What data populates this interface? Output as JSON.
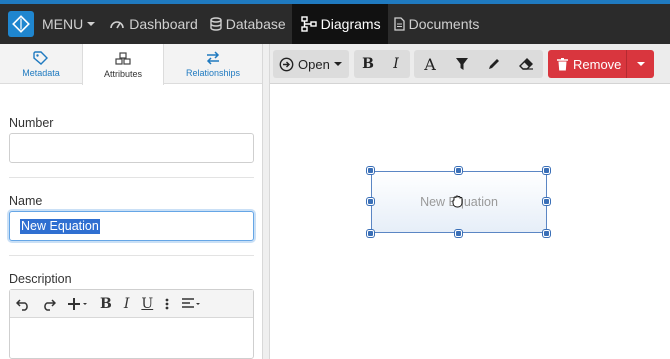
{
  "nav": {
    "menu_label": "MENU",
    "items": [
      {
        "label": "Dashboard",
        "icon": "dashboard-icon"
      },
      {
        "label": "Database",
        "icon": "database-icon"
      },
      {
        "label": "Diagrams",
        "icon": "diagram-icon",
        "active": true
      },
      {
        "label": "Documents",
        "icon": "document-icon"
      }
    ]
  },
  "left_panel": {
    "tabs": [
      {
        "label": "Metadata",
        "icon": "tag-icon"
      },
      {
        "label": "Attributes",
        "icon": "cubes-icon",
        "active": true
      },
      {
        "label": "Relationships",
        "icon": "swap-arrows-icon"
      }
    ],
    "fields": {
      "number": {
        "label": "Number",
        "value": ""
      },
      "name": {
        "label": "Name",
        "value": "New Equation"
      },
      "description": {
        "label": "Description",
        "value": ""
      }
    }
  },
  "toolbar": {
    "open_label": "Open",
    "remove_label": "Remove"
  },
  "canvas": {
    "node_label": "New Equation"
  },
  "colors": {
    "accent": "#1f7ac0",
    "nav_bg": "#2b2b2b",
    "danger": "#d9363e",
    "selection": "#2f6fd1"
  }
}
